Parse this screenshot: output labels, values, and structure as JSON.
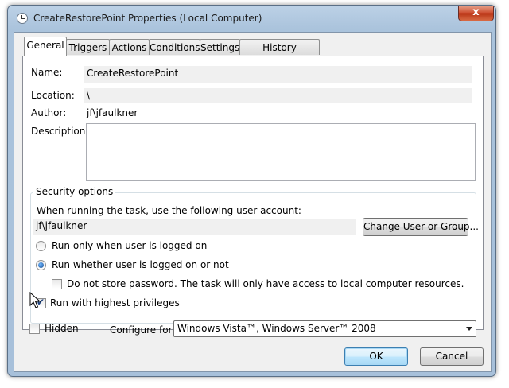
{
  "window": {
    "title": "CreateRestorePoint Properties (Local Computer)",
    "close_glyph": "x"
  },
  "tabs": [
    {
      "label": "General",
      "active": true
    },
    {
      "label": "Triggers"
    },
    {
      "label": "Actions"
    },
    {
      "label": "Conditions"
    },
    {
      "label": "Settings"
    },
    {
      "label": "History (disabled)"
    }
  ],
  "general": {
    "name_label": "Name:",
    "name_value": "CreateRestorePoint",
    "location_label": "Location:",
    "location_value": "\\",
    "author_label": "Author:",
    "author_value": "jf\\jfaulkner",
    "description_label": "Description:",
    "description_value": ""
  },
  "security": {
    "group_label": "Security options",
    "account_prompt": "When running the task, use the following user account:",
    "account_value": "jf\\jfaulkner",
    "change_user_button": "Change User or Group...",
    "radio_logged_on": "Run only when user is logged on",
    "radio_whether": "Run whether user is logged on or not",
    "radio_selected": "whether",
    "no_store_password": "Do not store password.  The task will only have access to local computer resources.",
    "no_store_password_checked": false,
    "highest_privileges": "Run with highest privileges",
    "highest_privileges_checked": true
  },
  "bottom": {
    "hidden_label": "Hidden",
    "hidden_checked": false,
    "configure_label": "Configure for:",
    "configure_value": "Windows Vista™, Windows Server™ 2008"
  },
  "buttons": {
    "ok": "OK",
    "cancel": "Cancel"
  },
  "icons": {
    "title": "clock-icon",
    "close": "close-icon",
    "dropdown": "chevron-down-icon",
    "cursor": "mouse-pointer-icon"
  }
}
